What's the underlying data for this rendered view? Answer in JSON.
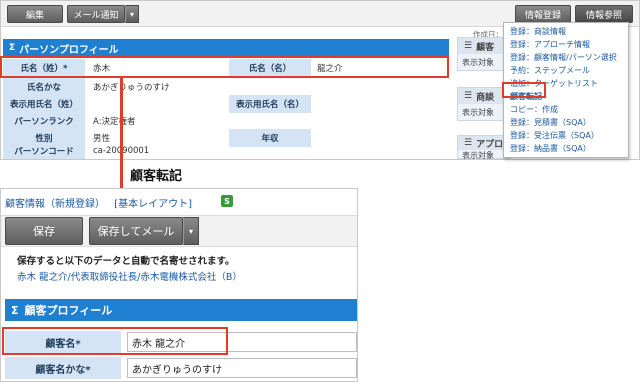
{
  "top_toolbar": {
    "edit_label": "編集",
    "mail_notify_label": "メール通知",
    "dropdown_glyph": "▾",
    "info_register_label": "情報登録",
    "info_view_label": "情報参照",
    "created_text": "作成日："
  },
  "person_profile": {
    "title": "パーソンプロフィール",
    "collapse_glyph": "Σ",
    "rows": [
      {
        "label": "氏名（姓）*",
        "value": "赤木",
        "label2": "氏名（名）",
        "value2": "龍之介"
      },
      {
        "label": "氏名かな",
        "value": "あかぎりゅうのすけ",
        "label2": "",
        "value2": ""
      },
      {
        "label": "表示用氏名（姓）",
        "value": "",
        "label2": "表示用氏名（名）",
        "value2": ""
      },
      {
        "label": "パーソンランク",
        "value": "A:決定権者",
        "label2": "",
        "value2": ""
      },
      {
        "label": "性別",
        "value": "男性",
        "label2": "年収",
        "value2": ""
      },
      {
        "label": "パーソンコード",
        "value": "ca-20090001",
        "label2": "",
        "value2": ""
      }
    ]
  },
  "side_panels": [
    {
      "heading": "顧客",
      "sub": "表示対象"
    },
    {
      "heading": "商談",
      "sub": "表示対象"
    },
    {
      "heading": "アプロ",
      "sub": "表示対象"
    }
  ],
  "context_menu": {
    "items": [
      "登録：商談情報",
      "登録：アプローチ情報",
      "登録：顧客情報/パーソン選択",
      "予約：ステップメール",
      "追加：ターゲットリスト",
      "顧客転記",
      "コピー：作成",
      "登録：見積書（SQA）",
      "登録：受注伝票（SQA）",
      "登録：納品書（SQA）"
    ]
  },
  "arrow_caption": "顧客転記",
  "customer_form": {
    "breadcrumb_title": "顧客情報（新規登録）",
    "layout_link": "[基本レイアウト]",
    "refresh_icon_glyph": "S",
    "save_label": "保存",
    "save_mail_label": "保存してメール",
    "dropdown_glyph": "▾",
    "notice_text": "保存すると以下のデータと自動で名寄せされます。",
    "notice_link": "赤木 龍之介/代表取締役社長/赤木電機株式会社（B）",
    "section_title": "顧客プロフィール",
    "collapse_glyph": "Σ",
    "fields": [
      {
        "label": "顧客名*",
        "value": "赤木 龍之介"
      },
      {
        "label": "顧客名かな*",
        "value": "あかぎりゅうのすけ"
      }
    ]
  },
  "colors": {
    "accent_blue": "#1f7fd0",
    "highlight_red": "#e03c2c",
    "label_bg": "#d4e4f4",
    "refresh_green": "#3a9a3a"
  }
}
